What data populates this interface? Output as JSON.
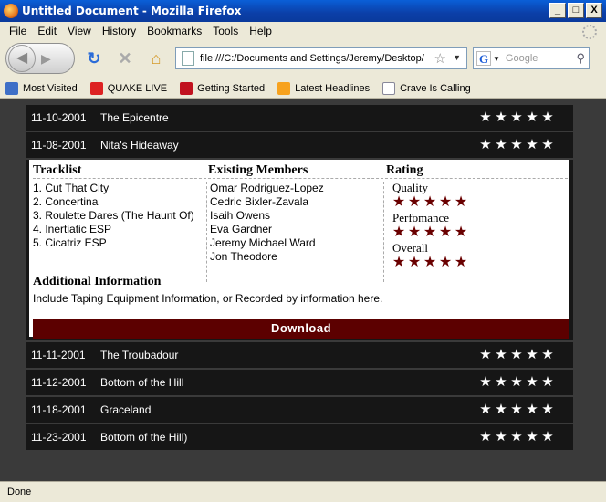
{
  "window": {
    "title": "Untitled Document - Mozilla Firefox",
    "buttons": [
      "_",
      "□",
      "X"
    ]
  },
  "menu": [
    "File",
    "Edit",
    "View",
    "History",
    "Bookmarks",
    "Tools",
    "Help"
  ],
  "toolbar": {
    "url": "file:///C:/Documents and Settings/Jeremy/Desktop/",
    "search_placeholder": "Google",
    "search_engine": "G"
  },
  "bookmarks": [
    "Most Visited",
    "QUAKE LIVE",
    "Getting Started",
    "Latest Headlines",
    "Crave Is Calling"
  ],
  "shows_top": [
    {
      "date": "11-10-2001",
      "venue": "The Epicentre",
      "stars": 5
    },
    {
      "date": "11-08-2001",
      "venue": "Nita's Hideaway",
      "stars": 5
    }
  ],
  "detail": {
    "tracklist_heading": "Tracklist",
    "tracks": [
      "1. Cut That City",
      "2. Concertina",
      "3. Roulette Dares (The Haunt Of)",
      "4. Inertiatic ESP",
      "5. Cicatriz ESP"
    ],
    "members_heading": "Existing Members",
    "members": [
      "Omar Rodriguez-Lopez",
      "Cedric Bixler-Zavala",
      "Isaih Owens",
      "Eva Gardner",
      "Jeremy Michael Ward",
      "Jon Theodore"
    ],
    "rating_heading": "Rating",
    "ratings": [
      {
        "label": "Quality",
        "stars": 5
      },
      {
        "label": "Perfomance",
        "stars": 5
      },
      {
        "label": "Overall",
        "stars": 5
      }
    ],
    "additional_heading": "Additional Information",
    "additional_text": "Include Taping Equipment Information, or Recorded by information here.",
    "download_label": "Download"
  },
  "shows_bottom": [
    {
      "date": "11-11-2001",
      "venue": "The Troubadour",
      "stars": 5
    },
    {
      "date": "11-12-2001",
      "venue": "Bottom of the Hill",
      "stars": 5
    },
    {
      "date": "11-18-2001",
      "venue": "Graceland",
      "stars": 5
    },
    {
      "date": "11-23-2001",
      "venue": "Bottom of the Hill)",
      "stars": 5
    }
  ],
  "status": "Done",
  "colors": {
    "titlebar": "#0b3fa8",
    "row_bg": "#161616",
    "accent": "#5c0000",
    "rating_star": "#6a0000"
  }
}
